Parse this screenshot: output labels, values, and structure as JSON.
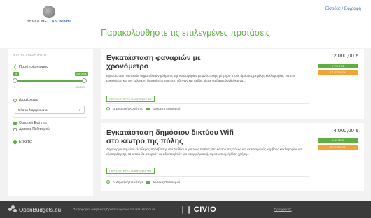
{
  "header": {
    "logo_text_prefix": "ΔΗΜΟΣ ",
    "logo_text_brand": "ΘΕΣΣΑΛΟΝΙΚΗΣ",
    "login_link": "Είσοδος / Εγγραφή",
    "page_title": "Παρακολουθήστε τις επιλεγμένες προτάσεις"
  },
  "sidebar": {
    "header": "ΦΙΛΤΡΑ ΑΝΑΖΗΤΗΣΗΣ",
    "budget": {
      "title": "Προϋπολογισμός",
      "min_label": "0€",
      "max_label": "100.000€",
      "min_value": "0",
      "max_value": "100.000"
    },
    "district": {
      "title": "Διαμέρισμα",
      "select_value": "Όλα τα διαμερίσματα"
    },
    "categories": [
      {
        "label": "Θεματική Ενότητα",
        "checked": true
      },
      {
        "label": "Δράσεις Πολιτισμού",
        "checked": false
      }
    ],
    "tags_title": "Ετικέτες"
  },
  "proposals": [
    {
      "title_line1": "Εγκατάσταση φαναριών με",
      "title_line2": "χρονόμετρο",
      "description": "Εγκατάσταση φωτεινών σηματοδοτών ρύθμισης της κυκλοφορίας με αντίστροφη μέτρηση στους δρόμους μεγάλης κυκλοφορίας, για την ευκολότερη και την καλύτερη δυνατή εξυπηρέτηση οδηγών και πεζών, ώστε να διευκολυνθεί και να...",
      "more_label": "ΠΕΡΙΣΣΟΤΕΡΕΣ ΠΛΗΡΟΦΟΡΙΕΣ",
      "district": "Δ' Δημοτική Κοινότητα",
      "category": "Δράσεις Πολιτισμού",
      "price": "12.000,00 €",
      "votes_badge": "1 ΨΗΦΟΣ",
      "status_badge": "ΣΕ ΕΞΕΛΙΞΗ"
    },
    {
      "title_line1": "Εγκατάσταση δημόσιου δικτύου Wifi",
      "title_line2": "στο κέντρο της πόλης",
      "description": "Δημιουργία σημείων ελεύθερης πρόσβασης στο Διαδίκτυο για τους πολίτες στο κέντρο της πόλης και σε κεντρικούς κόμβους κυκλοφορίας και εξυπηρέτησης, τα οποία θα μπορούν να αξιοποιηθούν για επαγγελματική, προσωπική, ή άλλη χρήση...",
      "more_label": "ΠΕΡΙΣΣΟΤΕΡΕΣ ΠΛΗΡΟΦΟΡΙΕΣ",
      "district": "Α' Δημοτική Κοινότητα",
      "category": "Δράσεις Πολιτισμού",
      "price": "4.000,00 €",
      "votes_badge": "4 ΨΗΦΟΙ",
      "status_badge": "ΣΕ ΕΞΕΛΙΞΗ"
    }
  ],
  "footer": {
    "brand": "OpenBudgets.eu",
    "credit": "Πληροφορίες διαφάνειας Προϋπολογισμός που εξελίσσεται σε",
    "partner": "CIVIO",
    "terms": "Όροι χρήσης"
  },
  "colors": {
    "accent": "#5fae42",
    "status_orange": "#f2a534",
    "footer_bg": "#3b3b3b",
    "link_blue": "#3a78c2"
  }
}
